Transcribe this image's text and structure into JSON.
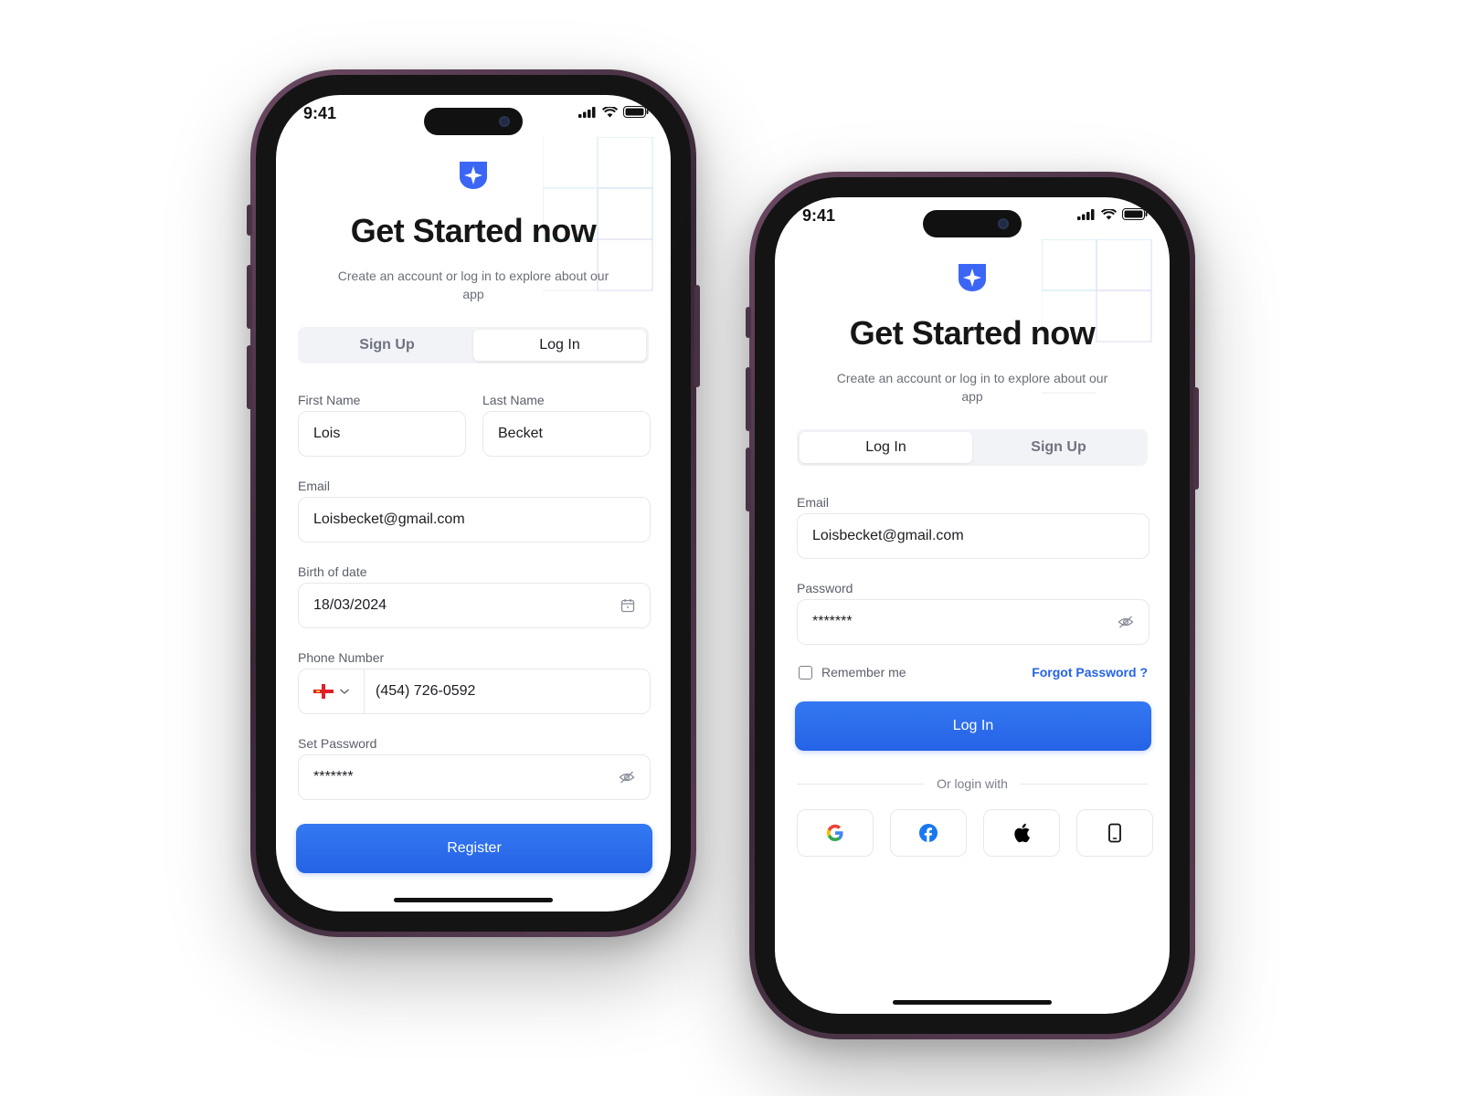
{
  "status_bar": {
    "time": "9:41"
  },
  "header": {
    "title": "Get Started now",
    "subtitle": "Create an account or log in to explore about our app"
  },
  "tabs": {
    "sign_up": "Sign Up",
    "log_in": "Log In"
  },
  "register_form": {
    "first_name_label": "First Name",
    "first_name_value": "Lois",
    "last_name_label": "Last Name",
    "last_name_value": "Becket",
    "email_label": "Email",
    "email_value": "Loisbecket@gmail.com",
    "birth_label": "Birth of date",
    "birth_value": "18/03/2024",
    "phone_label": "Phone Number",
    "phone_value": "(454) 726-0592",
    "password_label": "Set Password",
    "password_value": "*******",
    "submit_label": "Register"
  },
  "login_form": {
    "email_label": "Email",
    "email_value": "Loisbecket@gmail.com",
    "password_label": "Password",
    "password_value": "*******",
    "remember_label": "Remember me",
    "forgot_label": "Forgot Password ?",
    "submit_label": "Log In",
    "divider_label": "Or login with",
    "social": [
      "google-icon",
      "facebook-icon",
      "apple-icon",
      "phone-icon"
    ]
  },
  "colors": {
    "primary": "#2563e6",
    "logo": "#3b66f5",
    "frame": "#4a3345"
  }
}
